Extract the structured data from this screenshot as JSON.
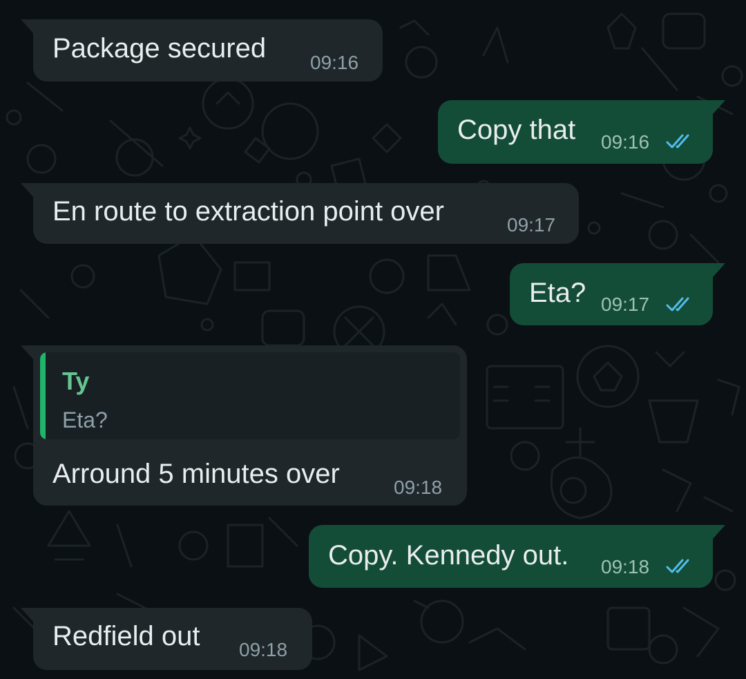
{
  "conversation": {
    "messages": [
      {
        "direction": "incoming",
        "text": "Package secured",
        "time": "09:16"
      },
      {
        "direction": "outgoing",
        "text": "Copy that",
        "time": "09:16",
        "status": "read",
        "status_icon": "double-check-icon",
        "status_color": "#53bdeb"
      },
      {
        "direction": "incoming",
        "text": "En route to extraction point over",
        "time": "09:17"
      },
      {
        "direction": "outgoing",
        "text": "Eta?",
        "time": "09:17",
        "status": "read",
        "status_icon": "double-check-icon",
        "status_color": "#53bdeb"
      },
      {
        "direction": "incoming",
        "text": "Arround 5 minutes over",
        "time": "09:18",
        "reply_to": {
          "author": "Ty",
          "text": "Eta?",
          "accent": "#1fb56b"
        }
      },
      {
        "direction": "outgoing",
        "text": "Copy. Kennedy out.",
        "time": "09:18",
        "status": "read",
        "status_icon": "double-check-icon",
        "status_color": "#53bdeb"
      },
      {
        "direction": "incoming",
        "text": "Redfield out",
        "time": "09:18"
      }
    ]
  },
  "colors": {
    "background": "#0b1014",
    "incoming_bubble": "#1f272a",
    "outgoing_bubble": "#144d37",
    "text": "#e9edef",
    "timestamp": "#8ea0a8",
    "read_ticks": "#53bdeb"
  }
}
